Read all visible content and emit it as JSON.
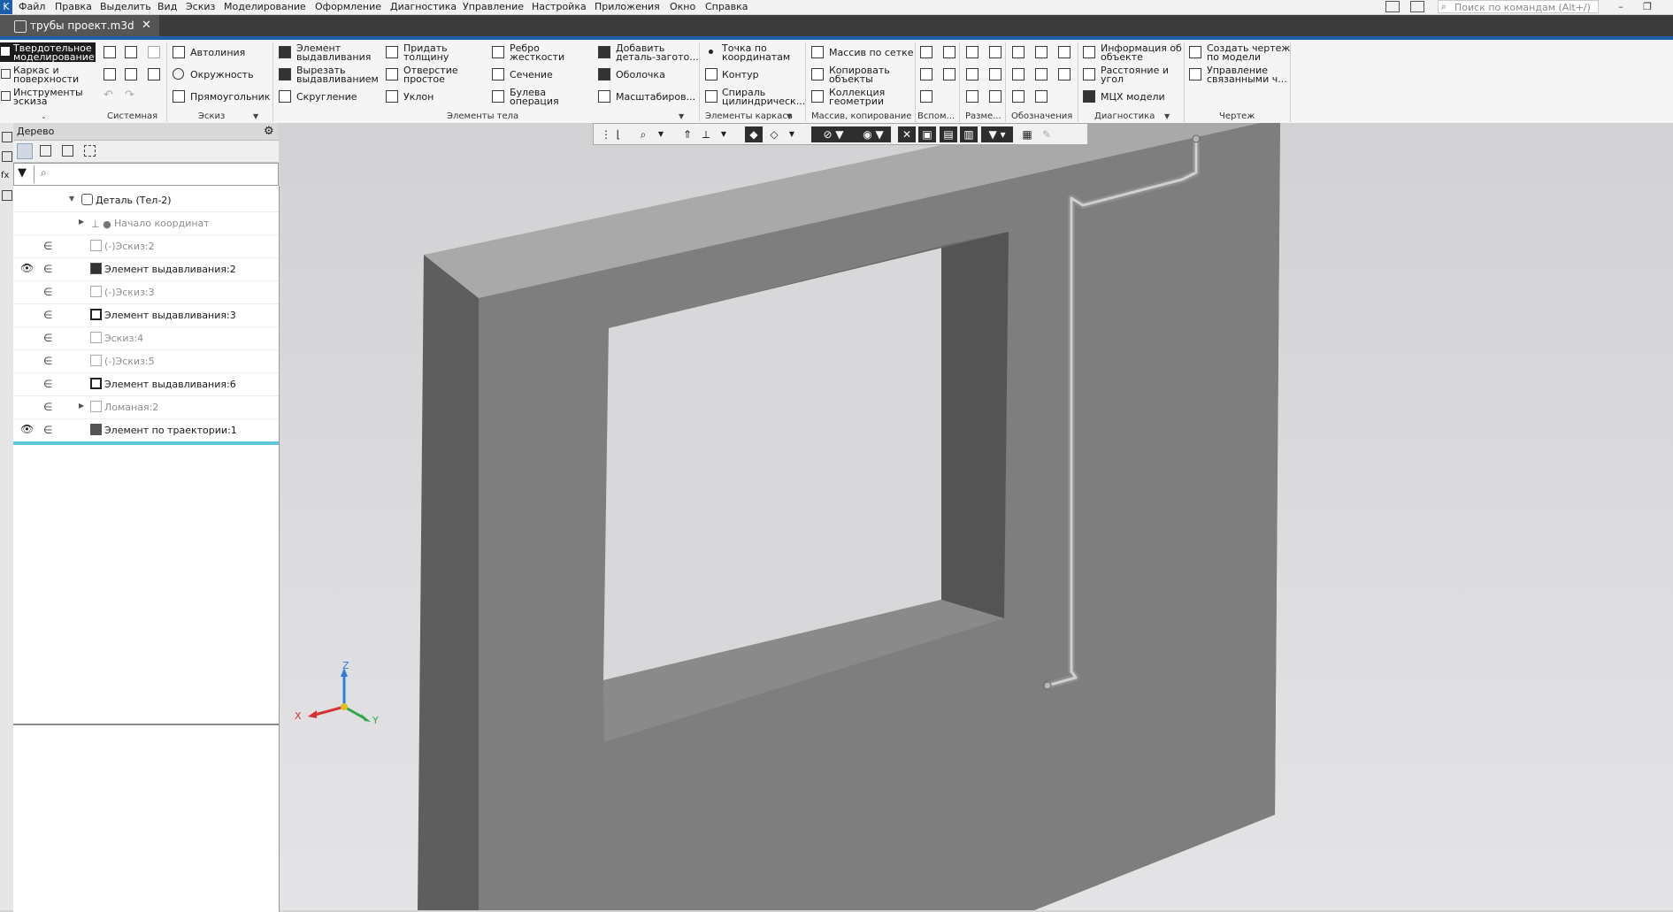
{
  "app": {
    "logo_label": "K"
  },
  "menu": [
    "Файл",
    "Правка",
    "Выделить",
    "Вид",
    "Эскиз",
    "Моделирование",
    "Оформление",
    "Диагностика",
    "Управление",
    "Настройка",
    "Приложения",
    "Окно",
    "Справка"
  ],
  "search": {
    "placeholder": "Поиск по командам (Alt+/)"
  },
  "document_tab": {
    "title": "трубы проект.m3d",
    "close": "✕"
  },
  "ribbon": {
    "modes": [
      "Твердотельное\nмоделирование",
      "Каркас и\nповерхности",
      "Инструменты\nэскиза"
    ],
    "sketch": [
      "Автолиния",
      "Окружность",
      "Прямоугольник"
    ],
    "body_col1": [
      "Элемент\nвыдавливания",
      "Вырезать\nвыдавливанием",
      "Скругление"
    ],
    "body_col2": [
      "Придать\nтолщину",
      "Отверстие\nпростое",
      "Уклон"
    ],
    "body_col3": [
      "Ребро\nжесткости",
      "Сечение",
      "Булева\nоперация"
    ],
    "body_col4": [
      "Добавить\nдеталь-загото...",
      "Оболочка",
      "Масштабиров..."
    ],
    "frame": [
      "Точка по\nкоординатам",
      "Контур",
      "Спираль\nцилиндрическ..."
    ],
    "array": [
      "Массив по сетке",
      "Копировать\nобъекты",
      "Коллекция\nгеометрии"
    ],
    "diag": [
      "Информация об\nобъекте",
      "Расстояние и\nугол",
      "МЦХ модели"
    ],
    "drawing": [
      "Создать чертеж\nпо модели",
      "Управление\nсвязанными ч..."
    ],
    "groups": [
      "Системная",
      "Эскиз",
      "Элементы тела",
      "Элементы каркаса",
      "Массив, копирование",
      "Вспом...",
      "Разме...",
      "Обозначения",
      "Диагностика",
      "Чертеж"
    ]
  },
  "tree": {
    "header": "Дерево",
    "rows": [
      {
        "label": "Деталь (Тел-2)",
        "eye": "",
        "inc": "",
        "dim": false
      },
      {
        "label": "Начало координат",
        "eye": "",
        "inc": "",
        "dim": true
      },
      {
        "label": "(-)Эскиз:2",
        "eye": "",
        "inc": "∈",
        "dim": true
      },
      {
        "label": "Элемент выдавливания:2",
        "eye": "👁",
        "inc": "∈",
        "dim": false
      },
      {
        "label": "(-)Эскиз:3",
        "eye": "",
        "inc": "∈",
        "dim": true
      },
      {
        "label": "Элемент выдавливания:3",
        "eye": "",
        "inc": "∈",
        "dim": false
      },
      {
        "label": "Эскиз:4",
        "eye": "",
        "inc": "∈",
        "dim": true
      },
      {
        "label": "(-)Эскиз:5",
        "eye": "",
        "inc": "∈",
        "dim": true
      },
      {
        "label": "Элемент выдавливания:6",
        "eye": "",
        "inc": "∈",
        "dim": false
      },
      {
        "label": "Ломаная:2",
        "eye": "",
        "inc": "∈",
        "dim": true
      },
      {
        "label": "Элемент по траектории:1",
        "eye": "👁",
        "inc": "∈",
        "dim": false
      }
    ]
  },
  "axes": {
    "x": "X",
    "y": "Y",
    "z": "Z"
  },
  "colors": {
    "accent": "#1e5fa6",
    "selection": "#5ec8dc",
    "wall_front": "#7e7e7e",
    "wall_top": "#a8a8a8",
    "wall_side": "#5e5e5e"
  }
}
